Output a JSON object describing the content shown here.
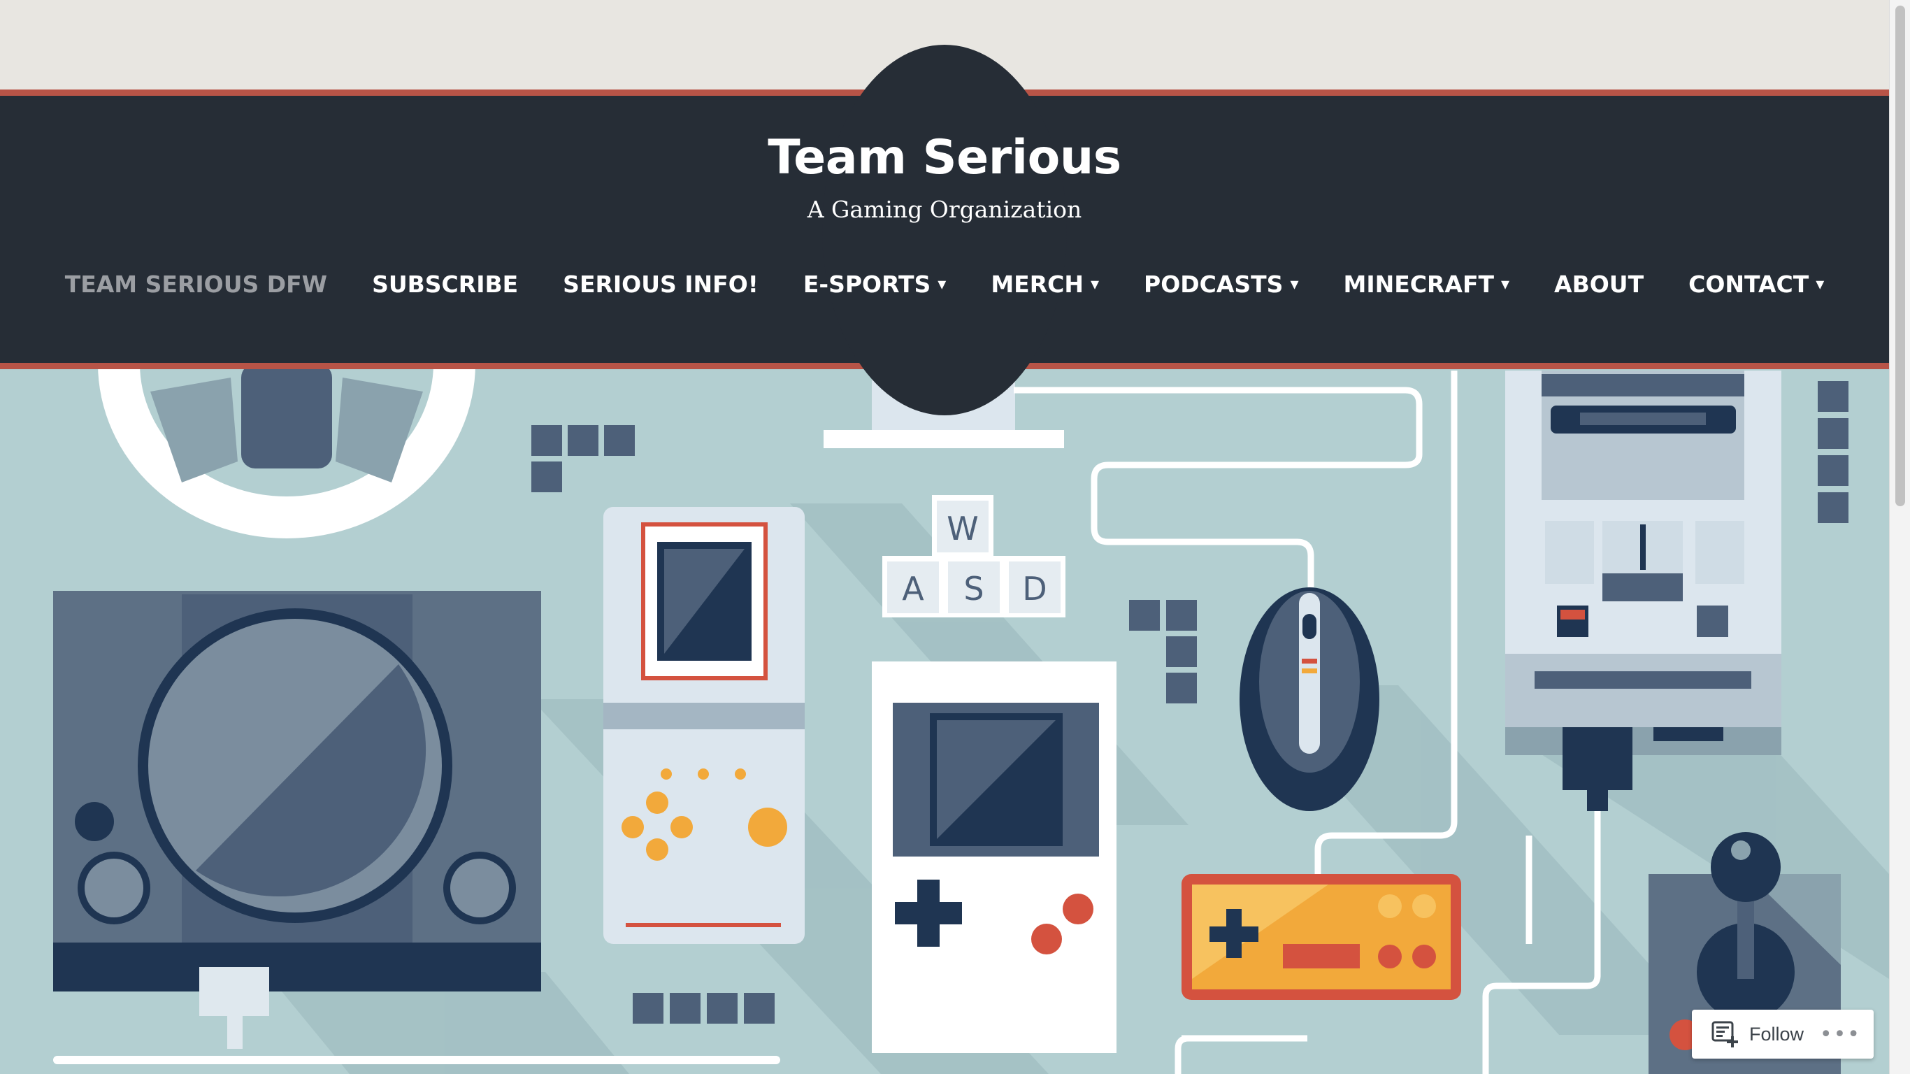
{
  "site": {
    "title": "Team Serious",
    "tagline": "A Gaming Organization"
  },
  "nav": {
    "items": [
      {
        "label": "TEAM SERIOUS DFW",
        "current": true,
        "dropdown": false
      },
      {
        "label": "SUBSCRIBE",
        "current": false,
        "dropdown": false
      },
      {
        "label": "SERIOUS INFO!",
        "current": false,
        "dropdown": false
      },
      {
        "label": "E-SPORTS",
        "current": false,
        "dropdown": true
      },
      {
        "label": "MERCH",
        "current": false,
        "dropdown": true
      },
      {
        "label": "PODCASTS",
        "current": false,
        "dropdown": true
      },
      {
        "label": "MINECRAFT",
        "current": false,
        "dropdown": true
      },
      {
        "label": "ABOUT",
        "current": false,
        "dropdown": false
      },
      {
        "label": "CONTACT",
        "current": false,
        "dropdown": true
      }
    ],
    "dropdown_glyph": "▾"
  },
  "hero": {
    "keycaps": [
      "W",
      "A",
      "S",
      "D"
    ]
  },
  "follow_widget": {
    "label": "Follow",
    "icon": "reader-follow-icon",
    "more_icon": "ellipsis-icon",
    "more_glyph": "•••"
  },
  "colors": {
    "header_bg": "#262d36",
    "accent_stripe": "#b85447",
    "hero_bg": "#b3cfd1",
    "top_band": "#e8e6e1",
    "nav_current": "#9b9ea3",
    "nav_text": "#ffffff"
  }
}
